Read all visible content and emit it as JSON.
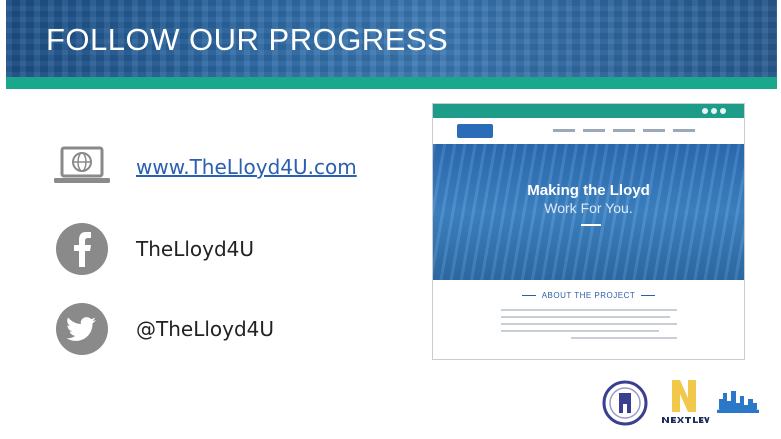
{
  "header": {
    "title": "FOLLOW OUR PROGRESS"
  },
  "contacts": [
    {
      "icon": "laptop-globe-icon",
      "text": "www.TheLloyd4U.com"
    },
    {
      "icon": "facebook-icon",
      "text": "TheLloyd4U"
    },
    {
      "icon": "twitter-icon",
      "text": "@TheLloyd4U"
    }
  ],
  "website_preview": {
    "hero_line1": "Making the Lloyd",
    "hero_line2": "Work For You.",
    "section_heading": "ABOUT THE PROJECT"
  },
  "logos": [
    {
      "icon": "indiana-seal-icon"
    },
    {
      "icon": "next-level-logo-icon"
    },
    {
      "icon": "city-skyline-logo-icon"
    }
  ],
  "colors": {
    "banner": "#2c68a3",
    "teal": "#1aa88c",
    "link": "#2b5fb0",
    "icon_gray": "#8a8a8a"
  }
}
